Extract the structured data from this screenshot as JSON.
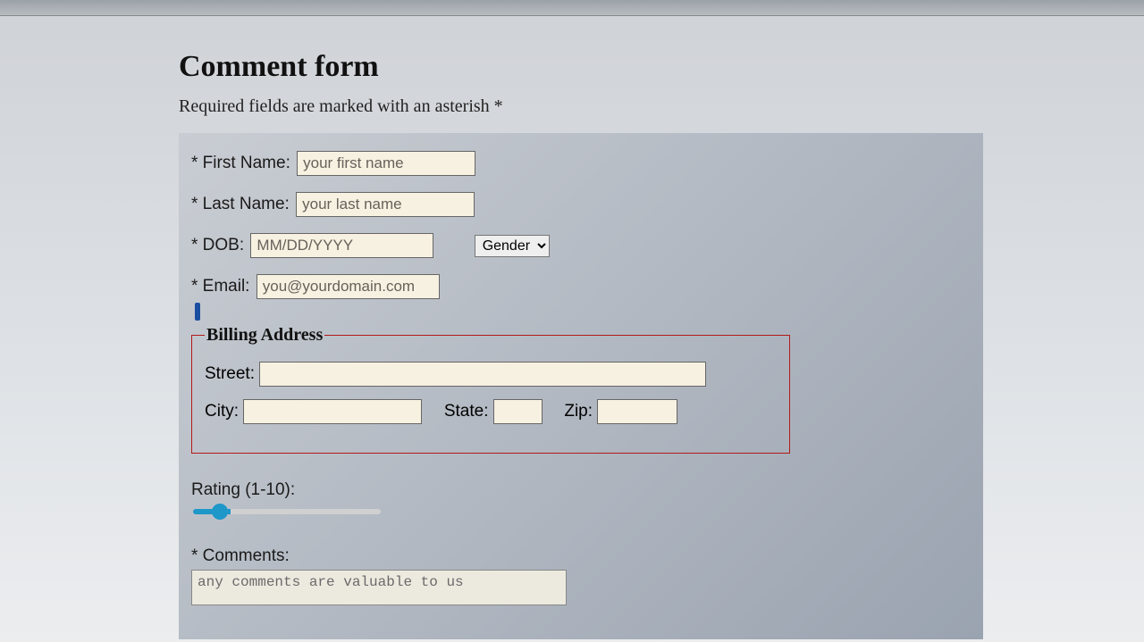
{
  "page": {
    "title": "Comment form",
    "subtitle": "Required fields are marked with an asterish *"
  },
  "fields": {
    "firstName": {
      "label": "* First Name:",
      "placeholder": "your first name",
      "value": ""
    },
    "lastName": {
      "label": "* Last Name:",
      "placeholder": "your last name",
      "value": ""
    },
    "dob": {
      "label": "* DOB:",
      "placeholder": "MM/DD/YYYY",
      "value": ""
    },
    "gender": {
      "label": "Gender",
      "options": [
        "Gender"
      ]
    },
    "email": {
      "label": "* Email:",
      "placeholder": "you@yourdomain.com",
      "value": ""
    }
  },
  "billing": {
    "legend": "Billing Address",
    "street": {
      "label": "Street:",
      "value": ""
    },
    "city": {
      "label": "City:",
      "value": ""
    },
    "state": {
      "label": "State:",
      "value": ""
    },
    "zip": {
      "label": "Zip:",
      "value": ""
    }
  },
  "rating": {
    "label": "Rating (1-10):",
    "min": 1,
    "max": 10,
    "value": 2
  },
  "comments": {
    "label": "* Comments:",
    "placeholder": "any comments are valuable to us",
    "value": ""
  }
}
